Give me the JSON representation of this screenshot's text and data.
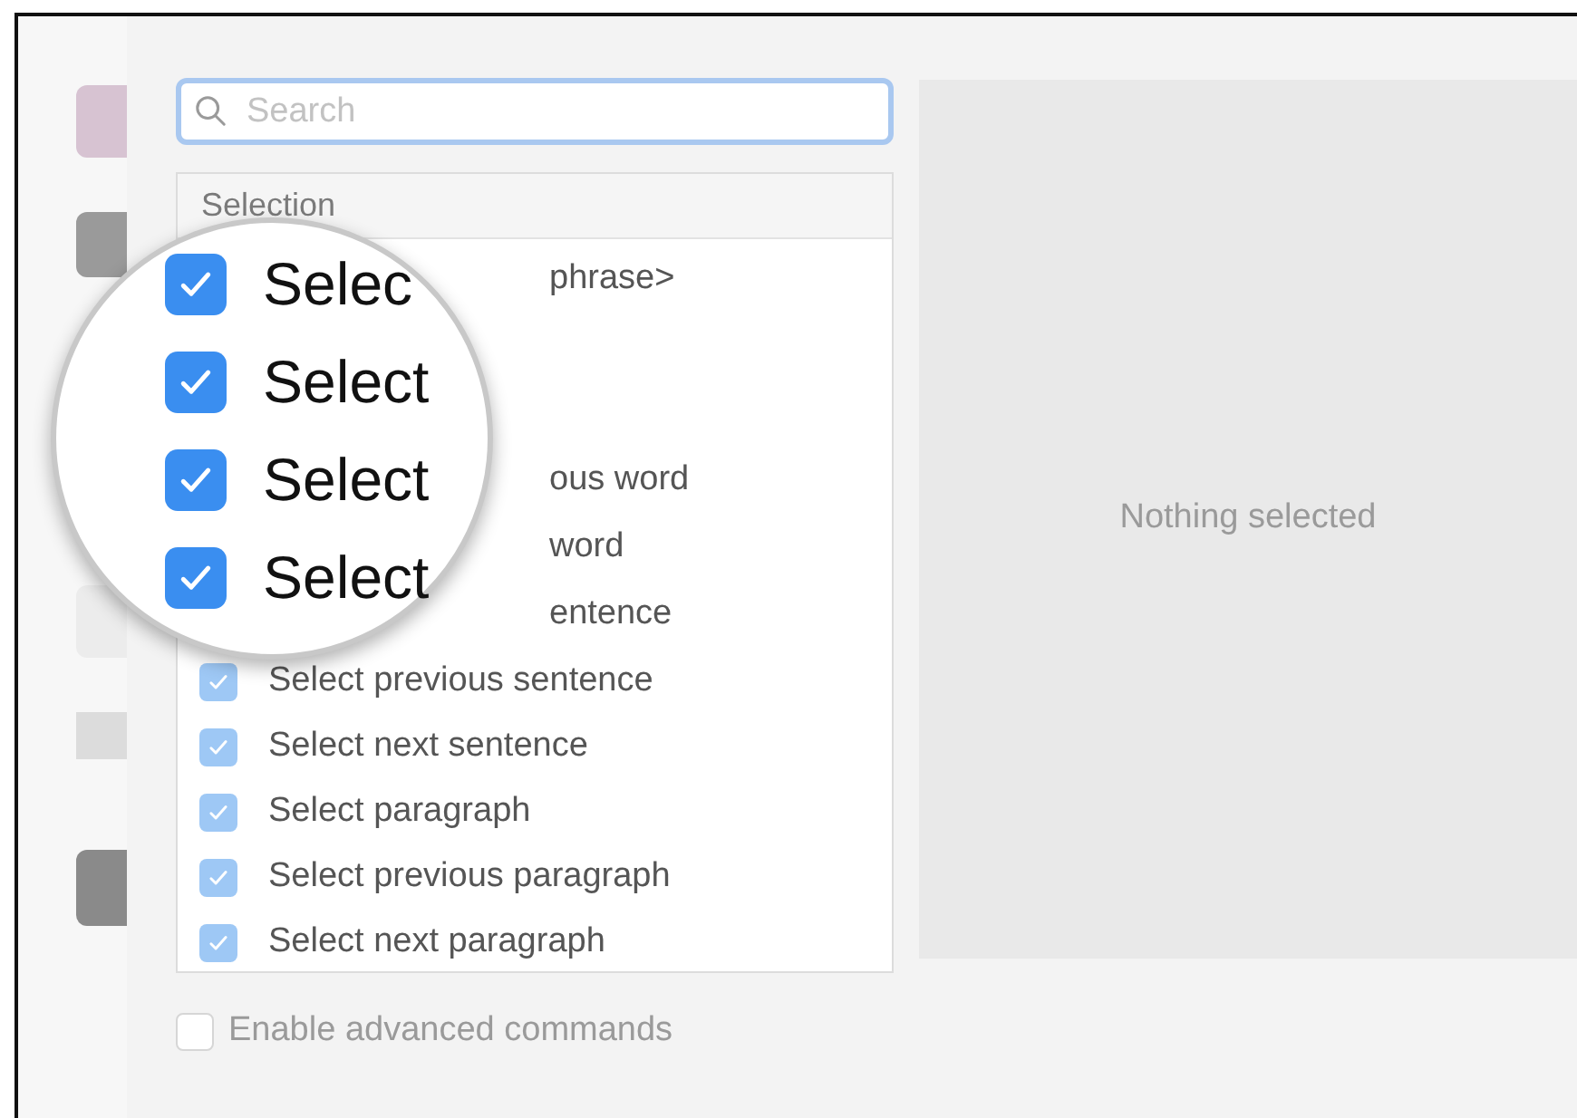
{
  "search": {
    "placeholder": "Search"
  },
  "list": {
    "header": "Selection",
    "rows": [
      {
        "kind": "tail",
        "text": "phrase>"
      },
      {
        "kind": "tail",
        "text": "ous word"
      },
      {
        "kind": "tail",
        "text": "word"
      },
      {
        "kind": "tail",
        "text": "entence"
      },
      {
        "kind": "full",
        "text": "Select previous sentence",
        "checked": true
      },
      {
        "kind": "full",
        "text": "Select next sentence",
        "checked": true
      },
      {
        "kind": "full",
        "text": "Select paragraph",
        "checked": true
      },
      {
        "kind": "full",
        "text": "Select previous paragraph",
        "checked": true
      },
      {
        "kind": "full",
        "text": "Select next paragraph",
        "checked": true
      }
    ]
  },
  "magnifier": {
    "rows": [
      {
        "text": "Selec",
        "checked": true
      },
      {
        "text": "Select",
        "checked": true
      },
      {
        "text": "Select",
        "checked": true
      },
      {
        "text": "Select",
        "checked": true
      }
    ]
  },
  "detail": {
    "empty_text": "Nothing selected"
  },
  "advanced": {
    "label": "Enable advanced commands",
    "checked": false
  }
}
